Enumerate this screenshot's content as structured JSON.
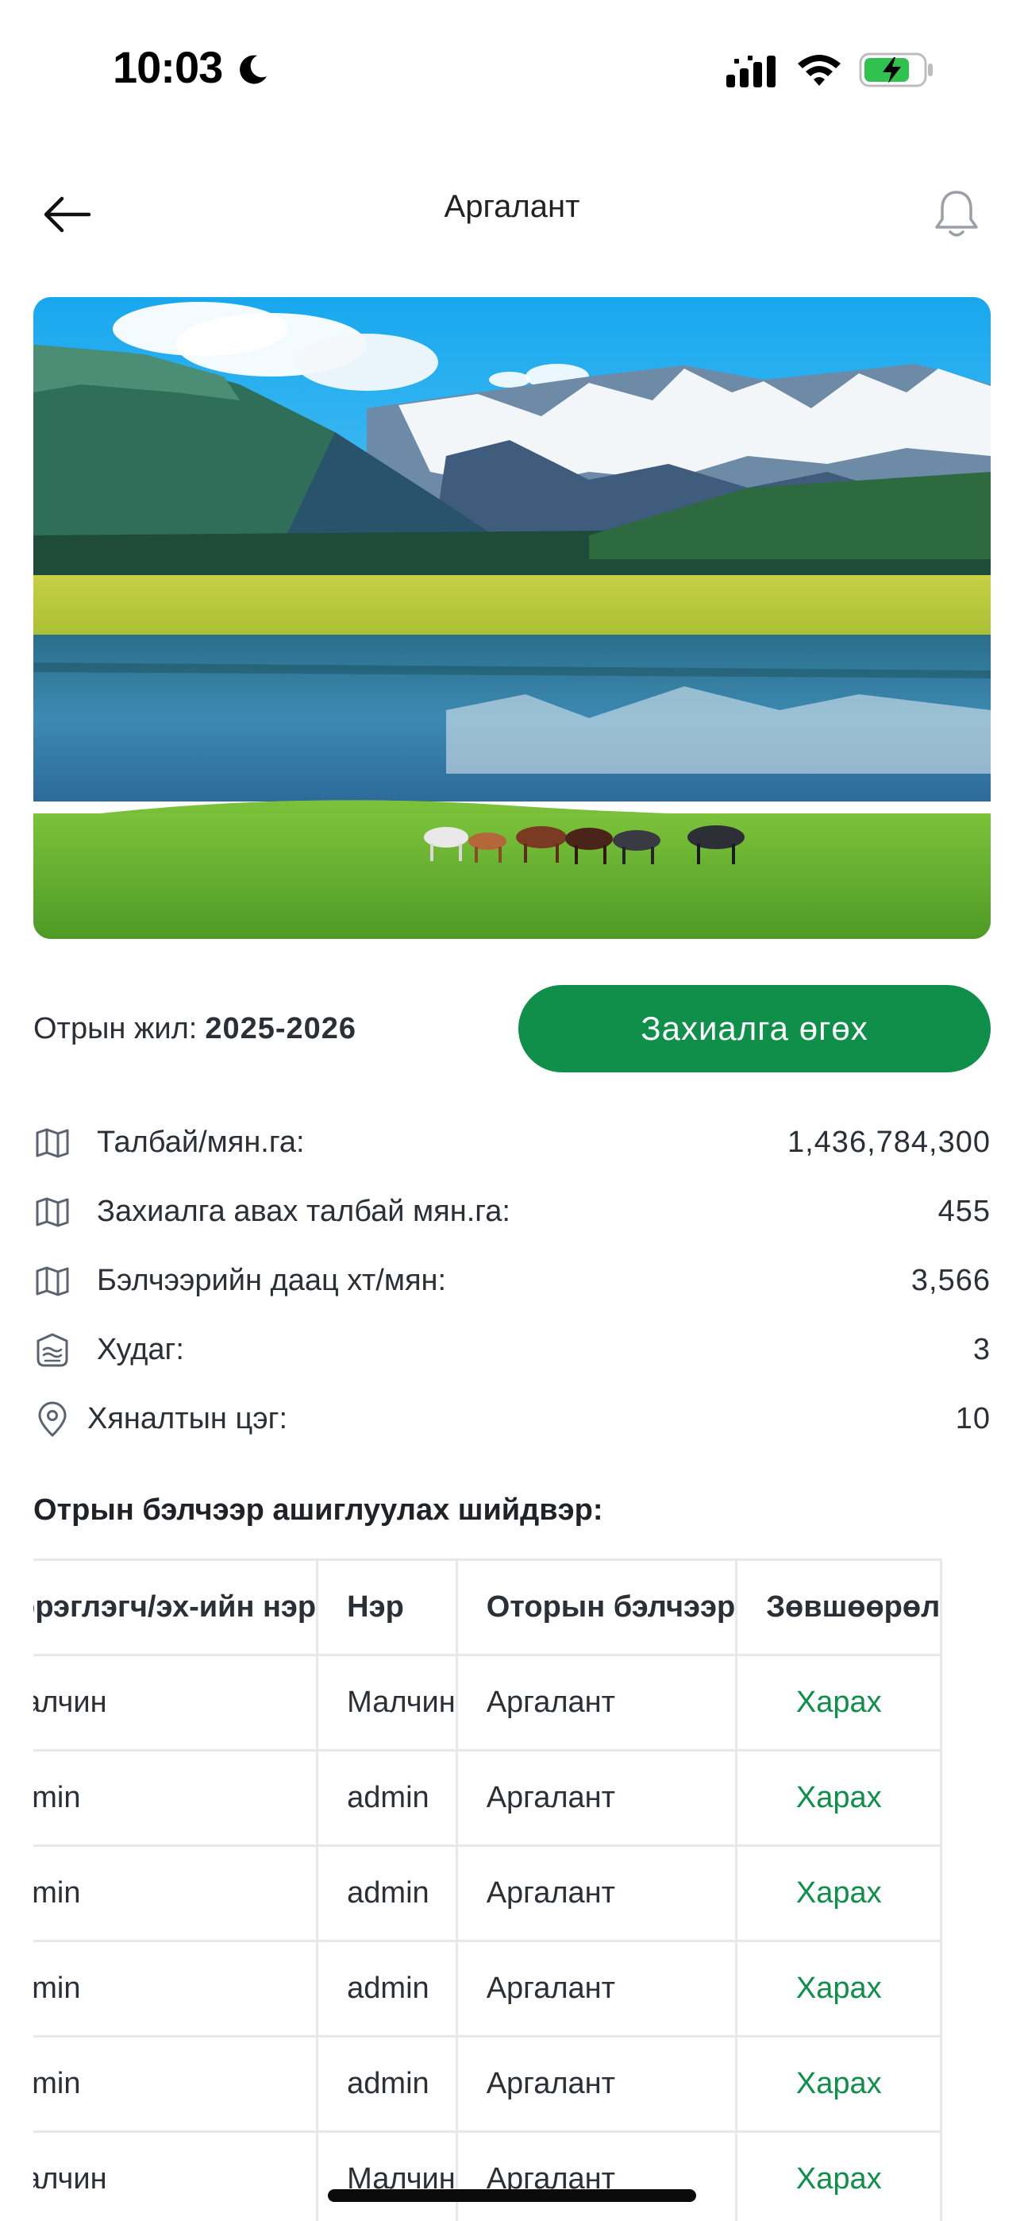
{
  "status_bar": {
    "time": "10:03",
    "icons": [
      "moon-icon",
      "cellular-signal-icon",
      "wifi-icon",
      "battery-charging-icon"
    ]
  },
  "nav": {
    "title": "Аргалант",
    "back_icon": "arrow-left-icon",
    "bell_icon": "bell-icon"
  },
  "hero": {
    "image": "mountain-lake-horses-photo"
  },
  "season": {
    "label": "Отрын жил:",
    "value": "2025-2026",
    "button_label": "Захиалга өгөх"
  },
  "info": [
    {
      "icon": "map-icon",
      "label": "Талбай/мян.га:",
      "value": "1,436,784,300"
    },
    {
      "icon": "map-icon",
      "label": "Захиалга авах талбай мян.га:",
      "value": "455"
    },
    {
      "icon": "map-icon",
      "label": "Бэлчээрийн даац хт/мян:",
      "value": "3,566"
    },
    {
      "icon": "well-icon",
      "label": "Худаг:",
      "value": "3"
    },
    {
      "icon": "location-pin-icon",
      "label": "Хяналтын цэг:",
      "value": "10"
    }
  ],
  "decision_section": {
    "title": "Отрын бэлчээр ашиглуулах шийдвэр:",
    "columns": [
      "Хэрэглэгч/эх-ийн нэр",
      "Нэр",
      "Оторын бэлчээр",
      "Зөвшөөрөл"
    ],
    "rows": [
      {
        "user": "Малчин",
        "name": "Малчин",
        "pasture": "Аргалант",
        "action": "Харах"
      },
      {
        "user": "admin",
        "name": "admin",
        "pasture": "Аргалант",
        "action": "Харах"
      },
      {
        "user": "admin",
        "name": "admin",
        "pasture": "Аргалант",
        "action": "Харах"
      },
      {
        "user": "admin",
        "name": "admin",
        "pasture": "Аргалант",
        "action": "Харах"
      },
      {
        "user": "admin",
        "name": "admin",
        "pasture": "Аргалант",
        "action": "Харах"
      },
      {
        "user": "Малчин",
        "name": "Малчин",
        "pasture": "Аргалант",
        "action": "Харах"
      }
    ]
  },
  "colors": {
    "accent": "#0f8f4a",
    "text": "#2b2f36",
    "border": "#e6e8ec"
  }
}
